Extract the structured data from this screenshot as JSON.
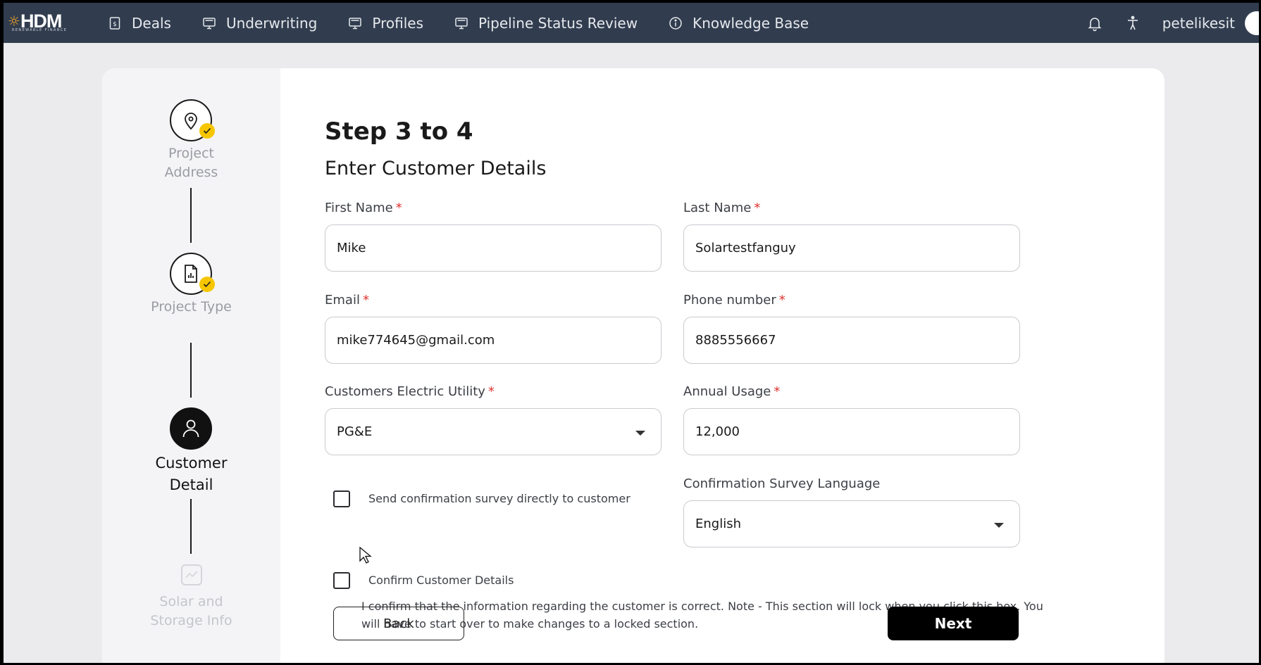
{
  "brand": {
    "logo_text": "HDM",
    "logo_subtext": "RENEWABLE FINANCE",
    "accent": "#f7c600"
  },
  "nav": {
    "items": [
      {
        "label": "Deals",
        "icon": "dollar-document-icon"
      },
      {
        "label": "Underwriting",
        "icon": "monitor-icon"
      },
      {
        "label": "Profiles",
        "icon": "monitor-icon"
      },
      {
        "label": "Pipeline Status Review",
        "icon": "monitor-icon"
      },
      {
        "label": "Knowledge Base",
        "icon": "info-icon"
      }
    ],
    "username": "petelikesit"
  },
  "stepper": {
    "steps": [
      {
        "label_line1": "Project",
        "label_line2": "Address",
        "state": "completed",
        "icon": "location-pin-icon"
      },
      {
        "label_line1": "Project Type",
        "label_line2": "",
        "state": "completed",
        "icon": "chart-document-icon"
      },
      {
        "label_line1": "Customer",
        "label_line2": "Detail",
        "state": "active",
        "icon": "user-icon"
      },
      {
        "label_line1": "Solar and",
        "label_line2": "Storage Info",
        "state": "upcoming",
        "icon": "line-chart-icon"
      }
    ]
  },
  "form": {
    "step_title": "Step 3 to 4",
    "subtitle": "Enter Customer Details",
    "required_marker": "*",
    "first_name": {
      "label": "First Name",
      "value": "Mike"
    },
    "last_name": {
      "label": "Last Name",
      "value": "Solartestfanguy"
    },
    "email": {
      "label": "Email",
      "value": "mike774645@gmail.com"
    },
    "phone": {
      "label": "Phone number",
      "value": "8885556667"
    },
    "utility": {
      "label": "Customers Electric Utility",
      "value": "PG&E"
    },
    "annual_usage": {
      "label": "Annual Usage",
      "value": "12,000"
    },
    "send_survey": {
      "label": "Send confirmation survey directly to customer",
      "checked": false
    },
    "survey_language": {
      "label": "Confirmation Survey Language",
      "value": "English"
    },
    "confirm": {
      "label": "Confirm Customer Details",
      "checked": false
    },
    "confirm_note": "I confirm that the information regarding the customer is correct. Note - This section will lock when you click this box. You will have to start over to make changes to a locked section.",
    "back_label": "Back",
    "next_label": "Next"
  }
}
